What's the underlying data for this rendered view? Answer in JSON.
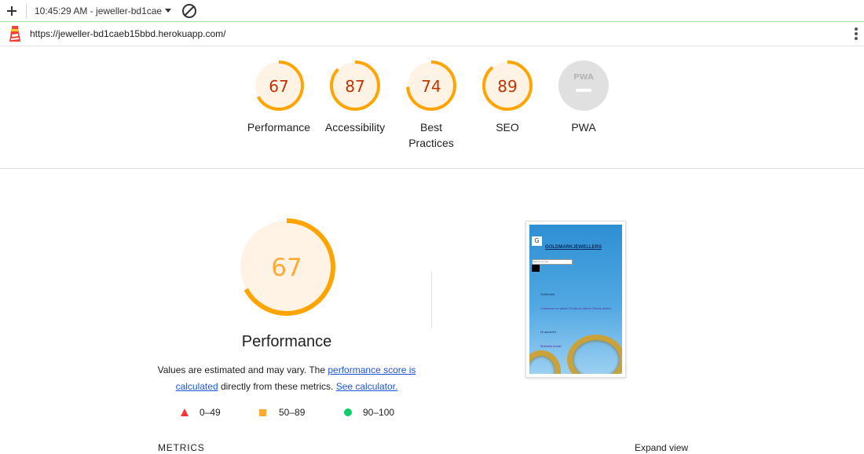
{
  "toolbar": {
    "run_label": "10:45:29 AM - jeweller-bd1cae"
  },
  "url": "https://jeweller-bd1caeb15bbd.herokuapp.com/",
  "colors": {
    "average": "#ffa400",
    "average_text": "#c33300",
    "average_bg": "#fff3e6",
    "fail": "#ff3333",
    "pass": "#0cce6b",
    "pwa_bg": "#e0e0e0"
  },
  "categories": [
    {
      "label": "Performance",
      "score": 67
    },
    {
      "label": "Accessibility",
      "score": 87
    },
    {
      "label": "Best Practices",
      "score": 74
    },
    {
      "label": "SEO",
      "score": 89
    },
    {
      "label": "PWA",
      "score": null,
      "badge": "PWA"
    }
  ],
  "performance": {
    "score": "67",
    "title": "Performance",
    "desc_prefix": "Values are estimated and may vary. The",
    "link1": "performance score is calculated",
    "desc_mid": "directly from these metrics.",
    "link2": "See calculator."
  },
  "legend": [
    {
      "icon": "red-triangle-icon",
      "range": "0–49"
    },
    {
      "icon": "orange-square-icon",
      "range": "50–89"
    },
    {
      "icon": "green-circle-icon",
      "range": "90–100"
    }
  ],
  "screenshot": {
    "brand": "GOLDMARKJEWELLERS",
    "logo": "G",
    "search_placeholder": "Search our site",
    "label1": "Guildmark",
    "links": "Cvinnerex en admin Producto admin Orders admin",
    "label2": "Hi admin01",
    "label3": "Mulhalla kvelat"
  },
  "metrics_label": "METRICS",
  "expand_view": "Expand view"
}
